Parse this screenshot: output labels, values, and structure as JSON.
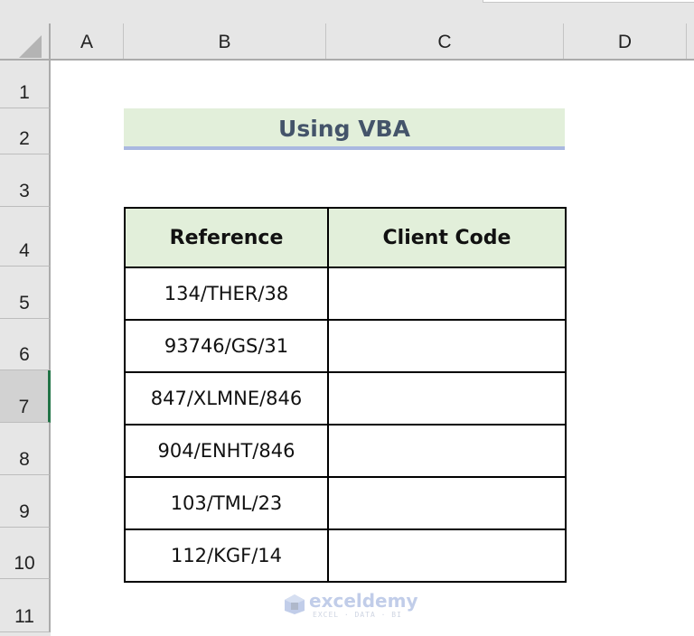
{
  "colors": {
    "title_fill": "#e2efda",
    "title_border": "#a9b8e0",
    "title_text": "#44546a",
    "header_fill": "#e2efda",
    "selection_accent": "#217346"
  },
  "columns": [
    "A",
    "B",
    "C",
    "D"
  ],
  "rows": [
    "1",
    "2",
    "3",
    "4",
    "5",
    "6",
    "7",
    "8",
    "9",
    "10",
    "11"
  ],
  "selected_row": "7",
  "title": "Using VBA",
  "table": {
    "headers": [
      "Reference",
      "Client Code"
    ],
    "rows": [
      {
        "reference": "134/THER/38",
        "client_code": ""
      },
      {
        "reference": "93746/GS/31",
        "client_code": ""
      },
      {
        "reference": "847/XLMNE/846",
        "client_code": ""
      },
      {
        "reference": "904/ENHT/846",
        "client_code": ""
      },
      {
        "reference": "103/TML/23",
        "client_code": ""
      },
      {
        "reference": "112/KGF/14",
        "client_code": ""
      }
    ]
  },
  "watermark": {
    "name": "exceldemy",
    "tagline": "EXCEL · DATA · BI",
    "icon": "exceldemy-logo-icon"
  }
}
